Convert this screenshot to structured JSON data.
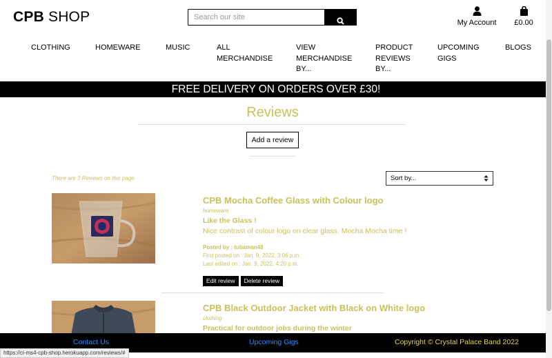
{
  "header": {
    "brand_bold": "CPB",
    "brand_rest": " SHOP",
    "search_placeholder": "Search our site",
    "account_label": "My Account",
    "bag_total": "£0.00"
  },
  "nav": {
    "items": [
      {
        "label": "CLOTHING"
      },
      {
        "label": "HOMEWARE"
      },
      {
        "label": "MUSIC"
      },
      {
        "label": "ALL MERCHANDISE"
      },
      {
        "label": "VIEW MERCHANDISE BY..."
      },
      {
        "label": "PRODUCT REVIEWS BY..."
      },
      {
        "label": "UPCOMING GIGS"
      },
      {
        "label": "BLOGS"
      }
    ]
  },
  "banner": {
    "text": "FREE DELIVERY ON ORDERS OVER £30!"
  },
  "main": {
    "title": "Reviews",
    "add_review_label": "Add a review",
    "count_text": "There are 3 Reviews on this page",
    "sort_label": "Sort by..."
  },
  "reviews": [
    {
      "product": "CPB Mocha Coffee Glass with Colour logo",
      "category": "homeware",
      "headline": "Like the Glass !",
      "body": "Nice contrast of colour logo on clear glass. Mocha Mocha time !",
      "posted_by": "Posted by : tubaman48",
      "first_posted": "First posted on : Jan. 9, 2022, 3:06 p.m.",
      "last_edited": "Last edited on : Jan. 9, 2022, 4:20 p.m.",
      "edit_label": "Edit review",
      "delete_label": "Delete review"
    },
    {
      "product": "CPB Black Outdoor Jacket with Black on White logo",
      "category": "clothing",
      "headline": "Practical for outdoor jobs during the winter"
    }
  ],
  "footer": {
    "contact": "Contact Us",
    "gigs": "Upcoming Gigs",
    "copyright": "Copyright © Crystal Palace Band 2022"
  },
  "status_url": "https://ci-ms4-cpb-shop.herokuapp.com/reviews/#",
  "colors": {
    "accent": "#c9c05a",
    "link": "#2b8fff",
    "footer_text": "#e6d84a",
    "banner_bg": "#000000"
  }
}
